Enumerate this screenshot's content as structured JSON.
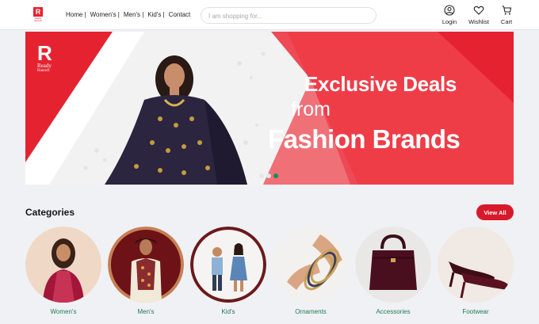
{
  "header": {
    "logo_mark": "R",
    "logo_text": "Ready Haunch",
    "nav": [
      "Home |",
      "Women's |",
      "Men's |",
      "Kid's |",
      "Contact"
    ],
    "search_placeholder": "I am shopping for...",
    "icons": [
      {
        "label": "Login",
        "icon": "user-circle-icon"
      },
      {
        "label": "Wishlist",
        "icon": "heart-icon"
      },
      {
        "label": "Cart",
        "icon": "cart-icon"
      }
    ]
  },
  "banner": {
    "brand_mark": "R",
    "brand_line1": "Ready",
    "brand_line2": "Haunch",
    "headline_line1": "Exclusive Deals",
    "headline_line2": "from",
    "headline_line3": "Fashion Brands",
    "slides": 3,
    "active_slide": 3,
    "colors": {
      "primary": "#e52330",
      "accent": "#f05a63",
      "dot_active": "#1b8c5a"
    }
  },
  "categories": {
    "title": "Categories",
    "view_all": "View All",
    "items": [
      "Women's",
      "Men's",
      "Kid's",
      "Ornaments",
      "Accessories",
      "Footwear"
    ]
  }
}
